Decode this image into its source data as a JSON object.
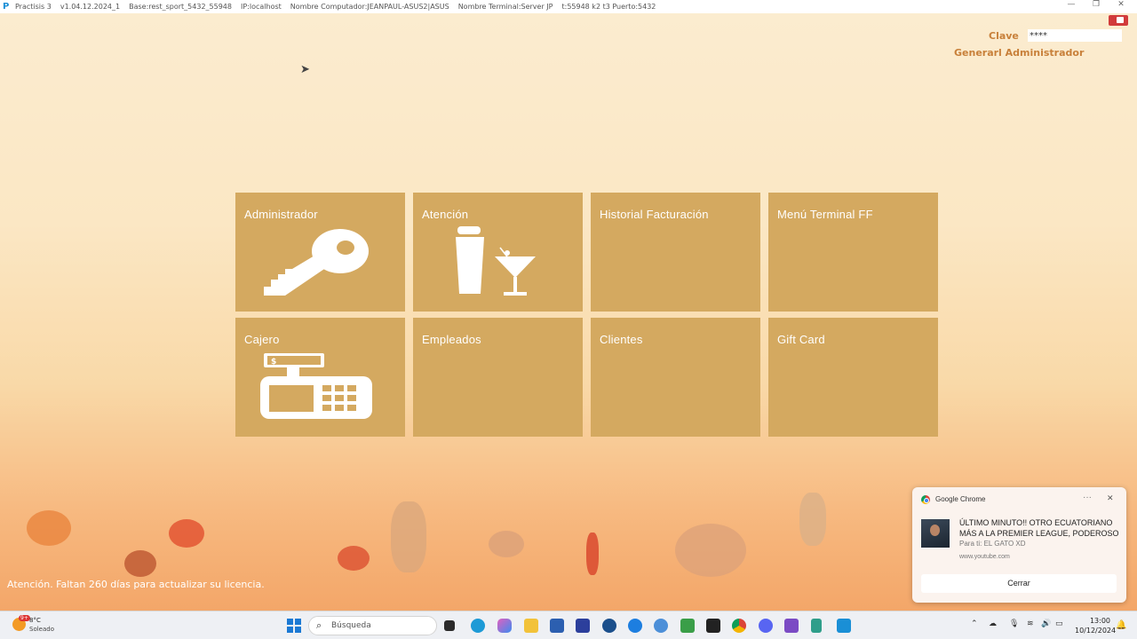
{
  "titlebar": {
    "app_name": "Practisis 3",
    "version": "v1.04.12.2024_1",
    "base": "Base:rest_sport_5432_55948",
    "ip": "IP:localhost",
    "computer": "Nombre Computador:JEANPAUL-ASUS2|ASUS",
    "terminal": "Nombre Terminal:Server JP",
    "extra": "t:55948 k2 t3 Puerto:5432"
  },
  "login": {
    "clave_label": "Clave",
    "clave_value": "****",
    "user_label": "Generarl Administrador"
  },
  "tiles": [
    {
      "label": "Administrador",
      "icon": "key-icon"
    },
    {
      "label": "Atención",
      "icon": "cocktail-shaker-icon"
    },
    {
      "label": "Historial Facturación",
      "icon": ""
    },
    {
      "label": "Menú Terminal FF",
      "icon": ""
    },
    {
      "label": "Cajero",
      "icon": "cash-register-icon"
    },
    {
      "label": "Empleados",
      "icon": ""
    },
    {
      "label": "Clientes",
      "icon": ""
    },
    {
      "label": "Gift Card",
      "icon": ""
    }
  ],
  "colors": {
    "tile": "#d4a960",
    "accent": "#c8803a"
  },
  "license_notice": "Atención. Faltan 260 días para actualizar su licencia.",
  "notification": {
    "app": "Google Chrome",
    "message": "ÚLTIMO MINUTO!! OTRO ECUATORIANO MÁS A LA PREMIER LEAGUE, PODEROSO",
    "subtitle": "Para ti: EL GATO XD",
    "url": "www.youtube.com",
    "close_button": "Cerrar"
  },
  "taskbar": {
    "weather_badge": "9+",
    "weather_temp": "8°C",
    "weather_status": "Soleado",
    "search_placeholder": "Búsqueda",
    "time": "13:00",
    "date": "10/12/2024"
  }
}
